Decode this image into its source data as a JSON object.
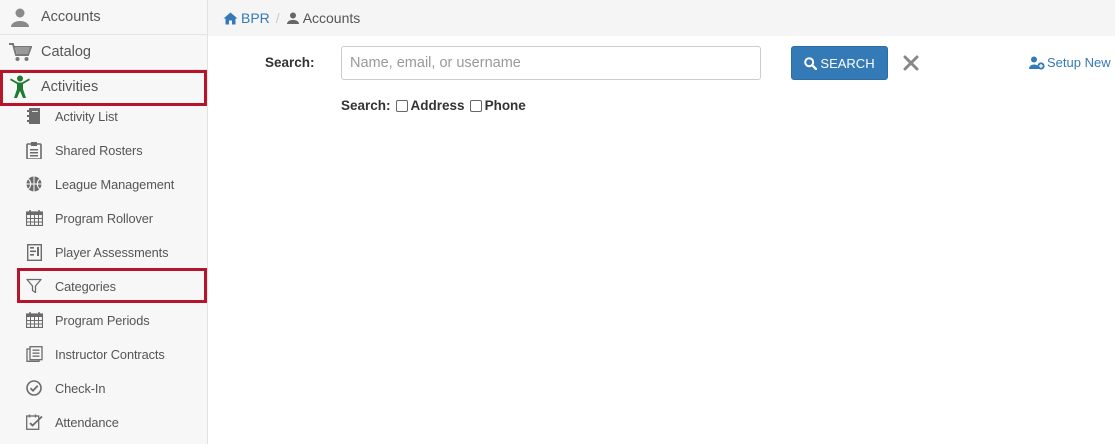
{
  "sidebar": {
    "top_items": [
      {
        "label": "Accounts",
        "icon": "user-icon"
      },
      {
        "label": "Catalog",
        "icon": "cart-icon"
      },
      {
        "label": "Activities",
        "icon": "person-activity-icon"
      }
    ],
    "sub_items": [
      {
        "label": "Activity List",
        "icon": "notebook-icon"
      },
      {
        "label": "Shared Rosters",
        "icon": "clipboard-icon"
      },
      {
        "label": "League Management",
        "icon": "basketball-icon"
      },
      {
        "label": "Program Rollover",
        "icon": "calendar-icon"
      },
      {
        "label": "Player Assessments",
        "icon": "assessment-icon"
      },
      {
        "label": "Categories",
        "icon": "filter-icon"
      },
      {
        "label": "Program Periods",
        "icon": "calendar-icon"
      },
      {
        "label": "Instructor Contracts",
        "icon": "contracts-icon"
      },
      {
        "label": "Check-In",
        "icon": "check-circle-icon"
      },
      {
        "label": "Attendance",
        "icon": "attendance-icon"
      }
    ],
    "highlighted": [
      "Activities",
      "Categories"
    ],
    "highlight_color": "#b5162b"
  },
  "breadcrumb": {
    "home": "BPR",
    "separator": "/",
    "current": "Accounts"
  },
  "search": {
    "label": "Search:",
    "placeholder": "Name, email, or username",
    "value": "",
    "button_label": "SEARCH",
    "options_label": "Search:",
    "options": [
      {
        "label": "Address",
        "checked": false
      },
      {
        "label": "Phone",
        "checked": false
      }
    ]
  },
  "actions": {
    "setup_new": "Setup New"
  },
  "colors": {
    "link": "#337ab7",
    "primary_button": "#337ab7",
    "activity_icon": "#1e7a33"
  }
}
